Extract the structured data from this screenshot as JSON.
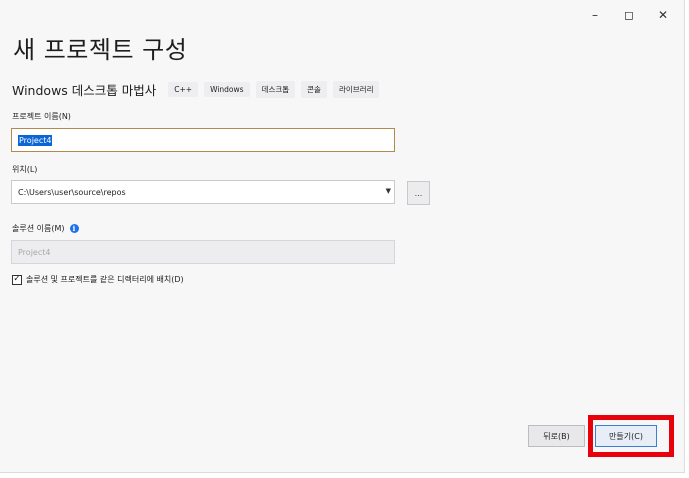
{
  "window": {
    "minimize_icon": "minimize-icon",
    "maximize_icon": "maximize-icon",
    "close_icon": "close-icon"
  },
  "title": "새 프로젝트 구성",
  "wizard": {
    "name": "Windows 데스크톱 마법사",
    "tags": [
      "C++",
      "Windows",
      "데스크톱",
      "콘솔",
      "라이브러리"
    ]
  },
  "project_name": {
    "label": "프로젝트 이름(N)",
    "value": "Project4"
  },
  "location": {
    "label": "위치(L)",
    "value": "C:\\Users\\user\\source\\repos",
    "browse_label": "..."
  },
  "solution_name": {
    "label": "솔루션 이름(M)",
    "value": "Project4"
  },
  "same_directory": {
    "label": "솔루션 및 프로젝트를 같은 디렉터리에 배치(D)",
    "checked": true
  },
  "buttons": {
    "back": "뒤로(B)",
    "create": "만들기(C)"
  },
  "colors": {
    "highlight": "#e8000b",
    "selection": "#0a66d6",
    "info": "#1a73e8"
  }
}
